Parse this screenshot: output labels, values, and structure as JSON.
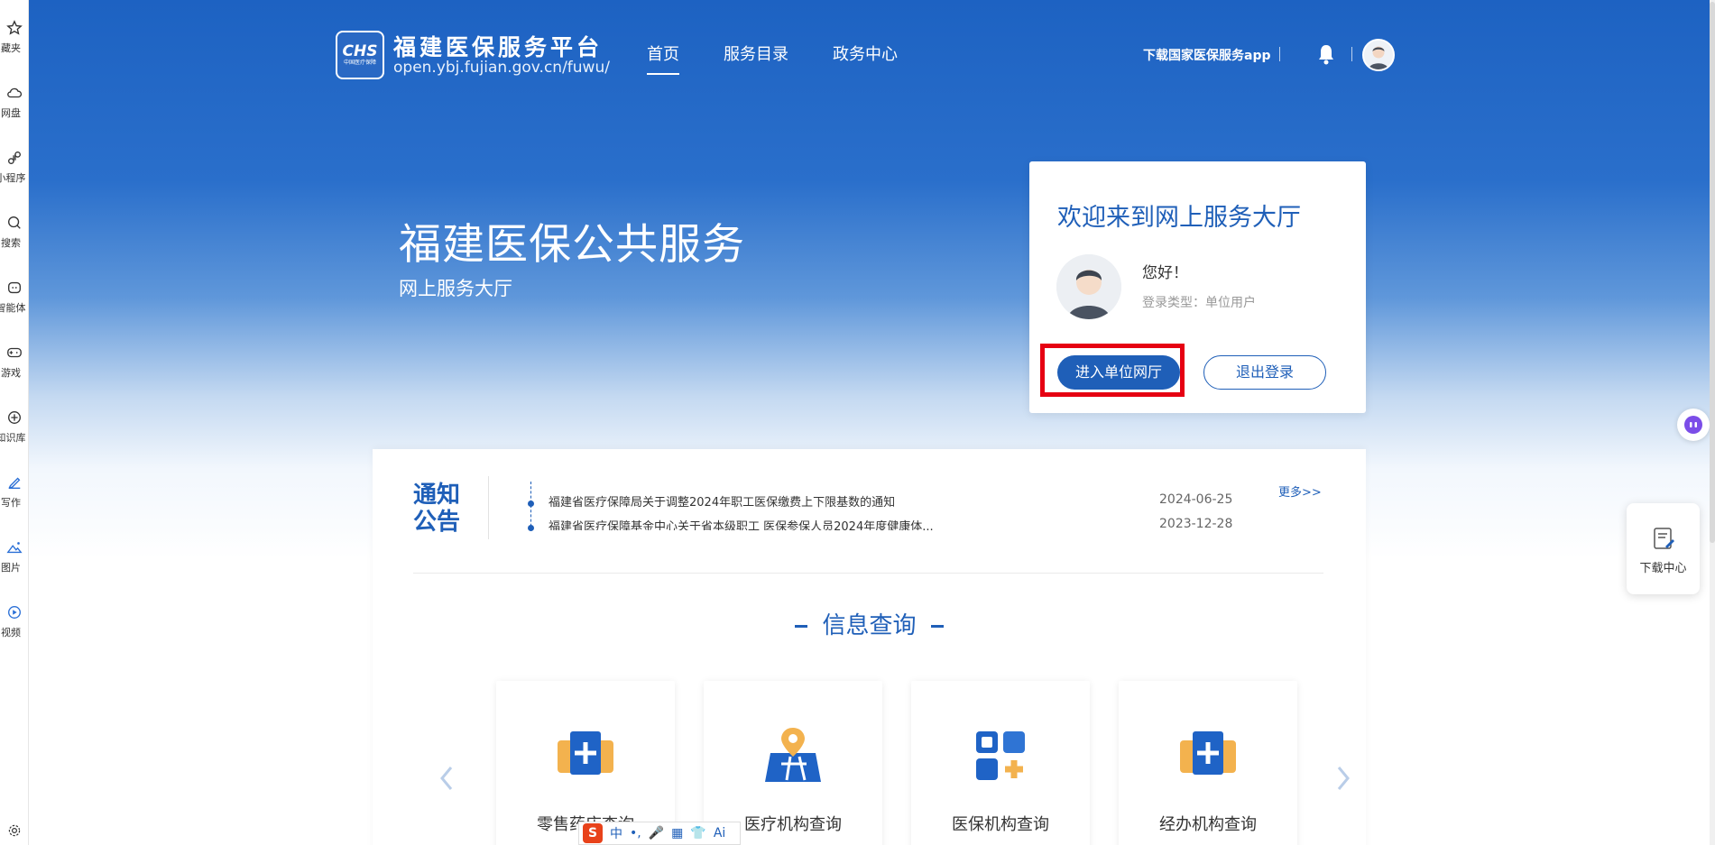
{
  "browser_rail": {
    "items": [
      {
        "icon": "star-icon",
        "label": "藏夹"
      },
      {
        "icon": "cloud-icon",
        "label": "网盘"
      },
      {
        "icon": "mini-program-icon",
        "label": "小程序"
      },
      {
        "icon": "search-icon",
        "label": "搜索"
      },
      {
        "icon": "agent-icon",
        "label": "智能体"
      },
      {
        "icon": "gamepad-icon",
        "label": "游戏"
      },
      {
        "icon": "knowledge-icon",
        "label": "知识库"
      },
      {
        "icon": "pen-icon",
        "label": "写作"
      },
      {
        "icon": "image-icon",
        "label": "图片"
      },
      {
        "icon": "video-icon",
        "label": "视频"
      }
    ]
  },
  "header": {
    "logo_text": "CHS",
    "logo_sub": "中国医疗保障",
    "site_name": "福建医保服务平台",
    "site_url": "open.ybj.fujian.gov.cn/fuwu/",
    "nav": [
      {
        "label": "首页",
        "active": true
      },
      {
        "label": "服务目录",
        "active": false
      },
      {
        "label": "政务中心",
        "active": false
      }
    ],
    "download_app": "下载国家医保服务app"
  },
  "hero": {
    "title": "福建医保公共服务",
    "subtitle": "网上服务大厅"
  },
  "welcome": {
    "title": "欢迎来到网上服务大厅",
    "greeting": "您好！",
    "login_type": "登录类型：单位用户",
    "enter_button": "进入单位网厅",
    "logout_button": "退出登录"
  },
  "notice": {
    "heading": "通知公告",
    "more": "更多>>",
    "items": [
      {
        "title": "福建省医疗保障局关于调整2024年职工医保缴费上下限基数的通知",
        "date": "2024-06-25"
      },
      {
        "title": "福建省医疗保障基金中心关于省本级职工 医保参保人员2024年度健康体...",
        "date": "2023-12-28"
      }
    ]
  },
  "info_query": {
    "title": "信息查询",
    "cards": [
      {
        "label": "零售药店查询",
        "icon": "pharmacy-icon"
      },
      {
        "label": "医疗机构查询",
        "icon": "map-location-icon"
      },
      {
        "label": "医保机构查询",
        "icon": "grid-plus-icon"
      },
      {
        "label": "经办机构查询",
        "icon": "medical-folder-icon"
      }
    ]
  },
  "download_center": {
    "label": "下载中心"
  },
  "ime": {
    "items": [
      "S",
      "中",
      "•,",
      "🎤",
      "▦",
      "👕",
      "Ai"
    ]
  },
  "colors": {
    "primary": "#1f5fb8",
    "header_blue": "#1d62c2",
    "highlight_red": "#e60012"
  }
}
